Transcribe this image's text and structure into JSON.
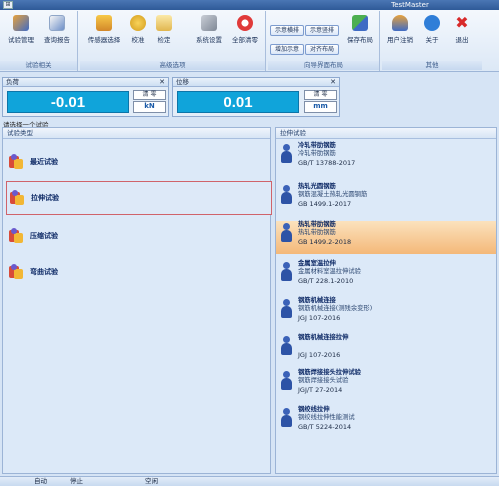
{
  "app": {
    "title": "TestMaster"
  },
  "ribbon": {
    "groups": [
      {
        "name": "试验相关",
        "buttons": [
          "试验管理",
          "查询报告"
        ]
      },
      {
        "name": "高级选项",
        "buttons": [
          "传感器选择",
          "校准",
          "检定",
          "系统设置",
          "全部清零"
        ]
      },
      {
        "name": "向导界面布局",
        "small_buttons": [
          "示意横排",
          "示意竖排",
          "增加示意",
          "对齐布局"
        ],
        "buttons": [
          "保存布局"
        ]
      },
      {
        "name": "其他",
        "buttons": [
          "用户注销",
          "关于",
          "退出"
        ]
      }
    ]
  },
  "load_panel": {
    "title": "负荷",
    "value": "-0.01",
    "clear": "清 零",
    "unit": "kN"
  },
  "disp_panel": {
    "title": "位移",
    "value": "0.01",
    "clear": "清 零",
    "unit": "mm"
  },
  "prompt": "请选择一个试验",
  "left": {
    "header": "试验类型",
    "categories": [
      "最近试验",
      "拉伸试验",
      "压缩试验",
      "弯曲试验"
    ]
  },
  "right": {
    "header": "拉伸试验",
    "standards": [
      {
        "title": "冷轧带肋钢筋",
        "desc": "冷轧带肋钢筋",
        "code": "GB/T 13788-2017"
      },
      {
        "title": "热轧光圆钢筋",
        "desc": "钢筋混凝土热轧光圆钢筋",
        "code": "GB 1499.1-2017"
      },
      {
        "title": "热轧带肋钢筋",
        "desc": "热轧带肋钢筋",
        "code": "GB 1499.2-2018"
      },
      {
        "title": "金属室温拉伸",
        "desc": "金属材料室温拉伸试验",
        "code": "GB/T 228.1-2010"
      },
      {
        "title": "钢筋机械连接",
        "desc": "钢筋机械连接(测残余变形)",
        "code": "JGJ 107-2016"
      },
      {
        "title": "钢筋机械连接拉伸",
        "desc": "",
        "code": "JGJ 107-2016"
      },
      {
        "title": "钢筋焊接接头拉伸试验",
        "desc": "钢筋焊接接头试验",
        "code": "JGJ/T 27-2014"
      },
      {
        "title": "钢绞线拉伸",
        "desc": "钢绞线拉伸性能测试",
        "code": "GB/T 5224-2014"
      }
    ]
  },
  "status": {
    "mode": "自动",
    "state": "停止",
    "idle": "空闲"
  },
  "colors": {
    "readout": "#10a4da",
    "highlight": "#f4b879",
    "selection_border": "#d0636b"
  }
}
